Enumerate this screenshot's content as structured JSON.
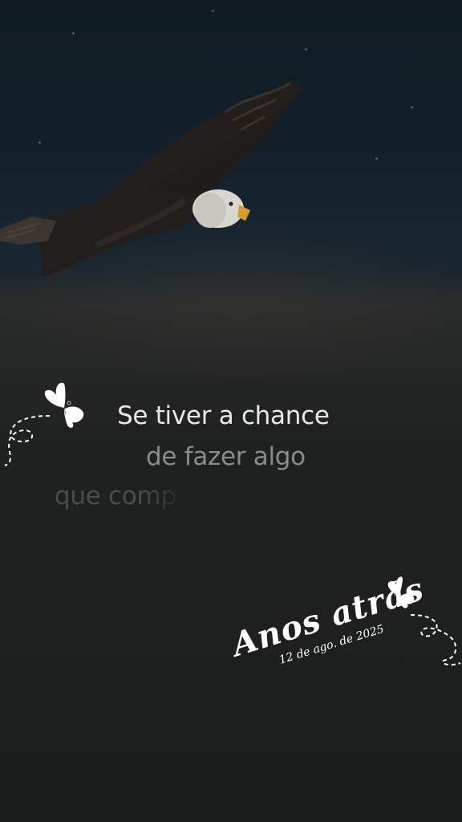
{
  "lyrics": {
    "line1": "Se tiver a chance",
    "line2": "de fazer algo",
    "line3": "que comp"
  },
  "memory_stamp": {
    "title": "Anos atrás",
    "date": "12 de ago. de 2025"
  },
  "icons": {
    "left_decoration": "butterfly-icon",
    "right_decoration": "butterfly-icon"
  },
  "colors": {
    "background": "#1d2021",
    "sky": "#13202a",
    "lyric_active": "#e8e8e8",
    "lyric_next": "#8a8c8c",
    "lyric_faded": "#4a4c4c",
    "stamp_text": "#ffffff"
  }
}
